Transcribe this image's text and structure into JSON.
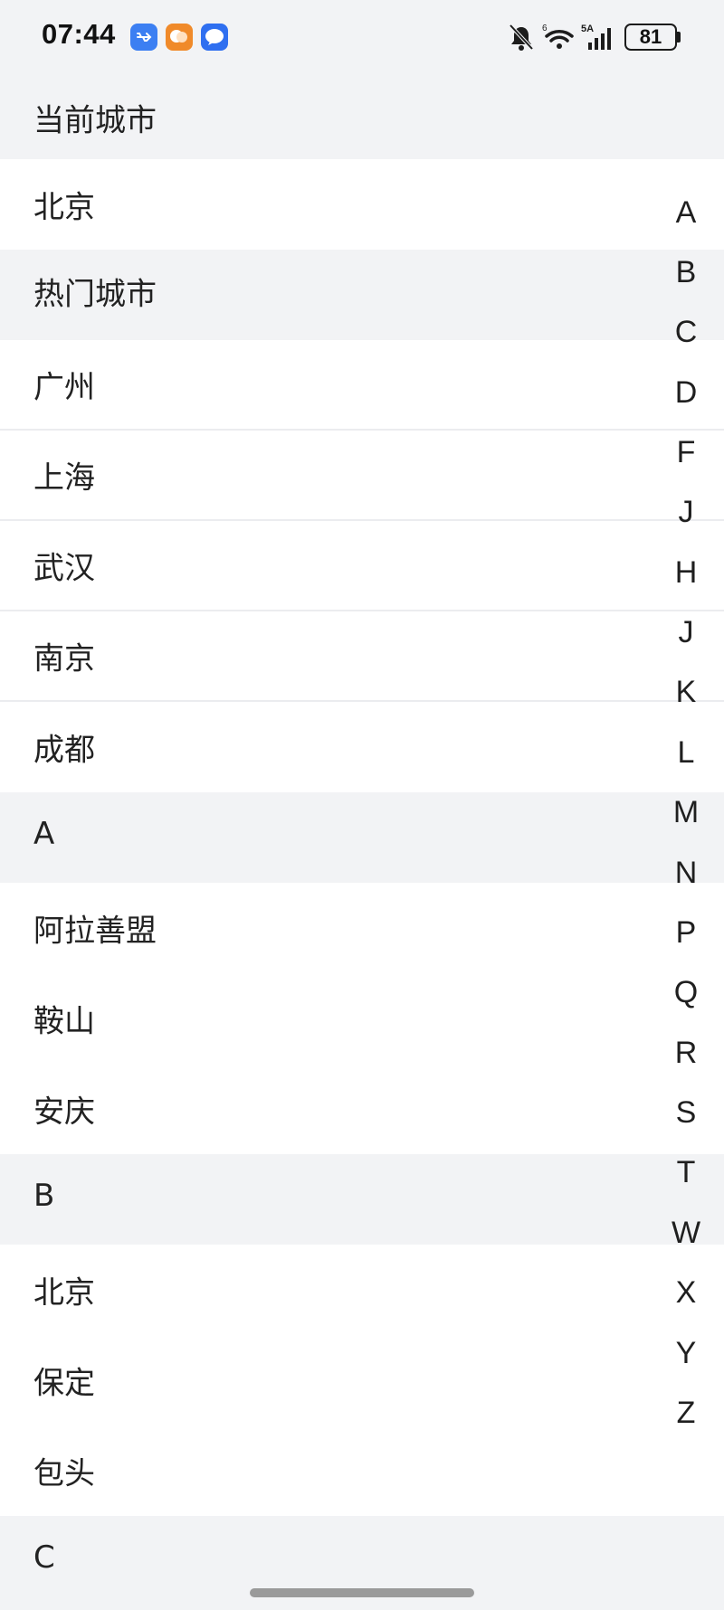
{
  "status_bar": {
    "time": "07:44",
    "battery": "81",
    "icons": [
      "usb-icon",
      "orange-chat-icon",
      "message-icon",
      "bell-off-icon",
      "wifi-icon",
      "signal-icon",
      "battery-icon"
    ]
  },
  "sections": {
    "current_city_title": "当前城市",
    "current_city": "北京",
    "hot_cities_title": "热门城市",
    "hot_cities": [
      "广州",
      "上海",
      "武汉",
      "南京",
      "成都"
    ],
    "a_title": "A",
    "a_cities": [
      "阿拉善盟",
      "鞍山",
      "安庆"
    ],
    "b_title": "B",
    "b_cities": [
      "北京",
      "保定",
      "包头"
    ],
    "c_title": "C"
  },
  "index": [
    "A",
    "B",
    "C",
    "D",
    "F",
    "J",
    "H",
    "J",
    "K",
    "L",
    "M",
    "N",
    "P",
    "Q",
    "R",
    "S",
    "T",
    "W",
    "X",
    "Y",
    "Z"
  ]
}
